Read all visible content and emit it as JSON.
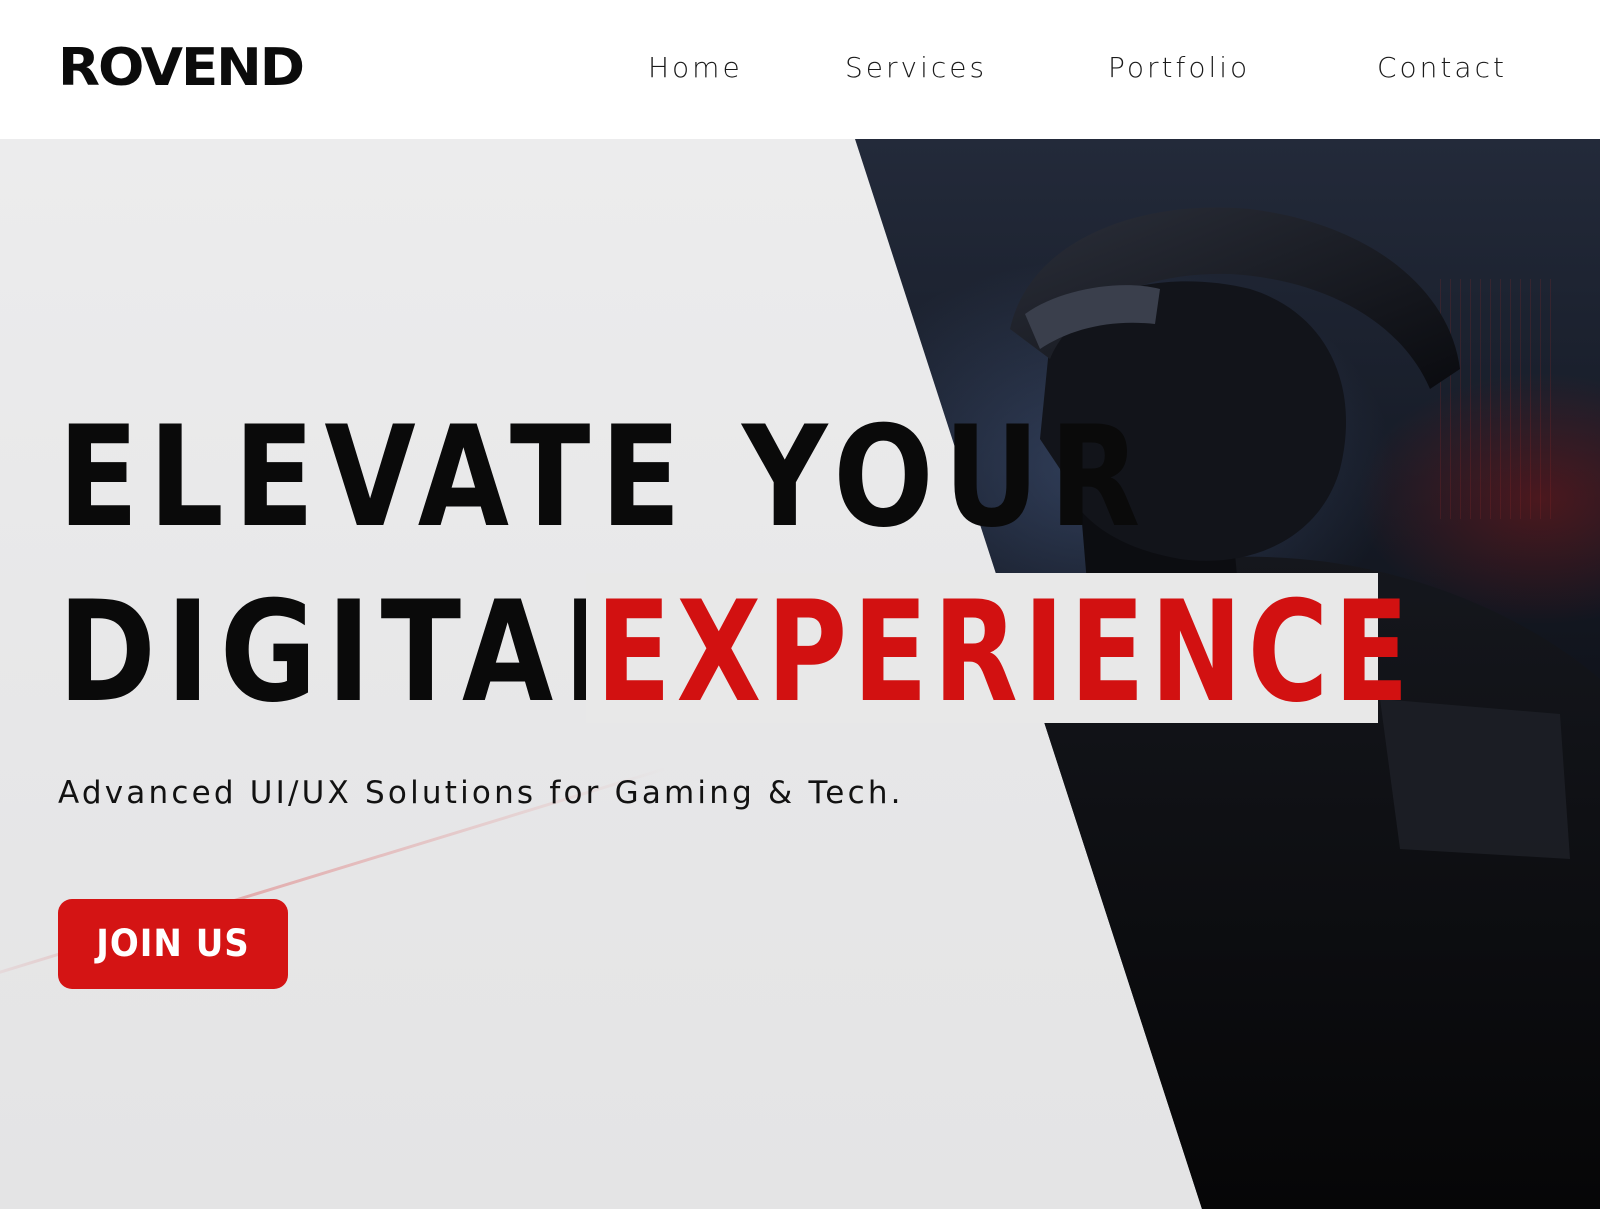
{
  "brand": {
    "name": "ROVEND"
  },
  "nav": {
    "items": [
      {
        "label": "Home"
      },
      {
        "label": "Services"
      },
      {
        "label": "Portfolio"
      },
      {
        "label": "Contact"
      }
    ]
  },
  "hero": {
    "headline_line1": "ELEVATE YOUR",
    "headline_line2": "DIGITAL",
    "headline_accent": "EXPERIENCE",
    "subtitle": "Advanced UI/UX Solutions for Gaming & Tech.",
    "cta_label": "JOIN US"
  },
  "colors": {
    "accent": "#d41414",
    "text": "#0a0a0a",
    "background": "#e9e9ea",
    "header": "#ffffff"
  }
}
